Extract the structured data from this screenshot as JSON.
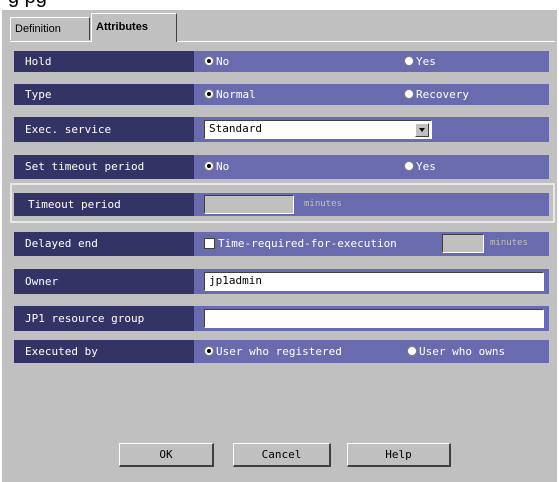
{
  "clipped_heading": "g                                    pg",
  "tabs": [
    {
      "label": "Definition",
      "active": false
    },
    {
      "label": "Attributes",
      "active": true
    }
  ],
  "rows": {
    "hold": {
      "label": "Hold",
      "options": [
        "No",
        "Yes"
      ],
      "selected": "No"
    },
    "type": {
      "label": "Type",
      "options": [
        "Normal",
        "Recovery"
      ],
      "selected": "Normal"
    },
    "exec_service": {
      "label": "Exec. service",
      "value": "Standard"
    },
    "set_timeout": {
      "label": "Set timeout period",
      "options": [
        "No",
        "Yes"
      ],
      "selected": "No"
    },
    "timeout_period": {
      "label": "Timeout period",
      "value": "",
      "unit": "minutes"
    },
    "delayed_end": {
      "label": "Delayed end",
      "checkbox_label": "Time-required-for-execution",
      "checked": false,
      "value": "",
      "unit": "minutes"
    },
    "owner": {
      "label": "Owner",
      "value": "jp1admin"
    },
    "jp1_resource_group": {
      "label": "JP1 resource group",
      "value": ""
    },
    "executed_by": {
      "label": "Executed by",
      "options": [
        "User who registered",
        "User who owns"
      ],
      "selected": "User who registered"
    }
  },
  "buttons": {
    "ok": "OK",
    "cancel": "Cancel",
    "help": "Help"
  },
  "colors": {
    "label_bg": "#333366",
    "value_bg": "#6a6aae",
    "dialog_bg": "#c0c0c0"
  }
}
